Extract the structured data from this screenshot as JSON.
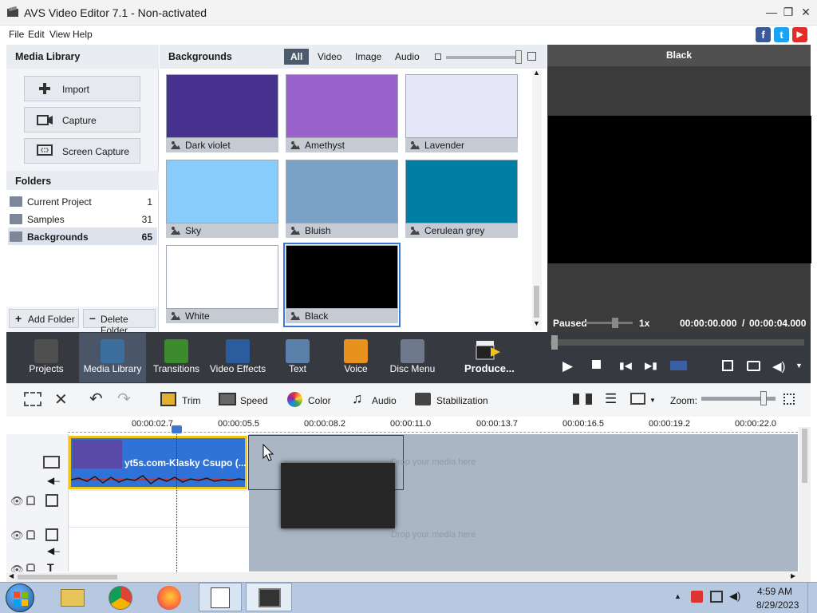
{
  "window": {
    "title": "AVS Video Editor 7.1 - Non-activated"
  },
  "menu": [
    "File",
    "Edit",
    "View",
    "Help"
  ],
  "social": [
    {
      "name": "facebook-icon",
      "glyph": "f",
      "color": "#3b5998"
    },
    {
      "name": "twitter-icon",
      "glyph": "t",
      "color": "#1da1f2"
    },
    {
      "name": "youtube-icon",
      "glyph": "▶",
      "color": "#e52d27"
    }
  ],
  "media_library": {
    "title": "Media Library",
    "buttons": [
      {
        "label": "Import",
        "icon": "plus-icon"
      },
      {
        "label": "Capture",
        "icon": "camera-icon"
      },
      {
        "label": "Screen Capture",
        "icon": "screen-capture-icon"
      }
    ],
    "folders_title": "Folders",
    "folders": [
      {
        "name": "Current Project",
        "count": "1"
      },
      {
        "name": "Samples",
        "count": "31"
      },
      {
        "name": "Backgrounds",
        "count": "65"
      }
    ],
    "add_folder": "Add Folder",
    "delete_folder": "Delete Folder"
  },
  "backgrounds": {
    "title": "Backgrounds",
    "tabs": [
      "All",
      "Video",
      "Image",
      "Audio"
    ],
    "active_tab": "All",
    "tiles": [
      {
        "name": "Dark violet",
        "color": "#46318f"
      },
      {
        "name": "Amethyst",
        "color": "#9c62cc"
      },
      {
        "name": "Lavender",
        "color": "#e6e6f9"
      },
      {
        "name": "Sky",
        "color": "#88ccfc"
      },
      {
        "name": "Bluish",
        "color": "#7aa2c6"
      },
      {
        "name": "Cerulean grey",
        "color": "#007fa5"
      },
      {
        "name": "White",
        "color": "#ffffff"
      },
      {
        "name": "Black",
        "color": "#000000"
      }
    ]
  },
  "preview": {
    "title": "Black",
    "status": "Paused",
    "speed": "1x",
    "time_current": "00:00:00.000",
    "time_sep": "/",
    "time_total": "00:00:04.000"
  },
  "modes": [
    {
      "label": "Projects",
      "icon": "projects-icon",
      "color": "#4f4f4f"
    },
    {
      "label": "Media Library",
      "icon": "media-library-icon",
      "color": "#3b6e9c"
    },
    {
      "label": "Transitions",
      "icon": "transitions-icon",
      "color": "#3b8b2e"
    },
    {
      "label": "Video Effects",
      "icon": "video-effects-icon",
      "color": "#2b5d9e"
    },
    {
      "label": "Text",
      "icon": "text-icon",
      "color": "#5a7fa8"
    },
    {
      "label": "Voice",
      "icon": "voice-icon",
      "color": "#e8911d"
    },
    {
      "label": "Disc Menu",
      "icon": "disc-menu-icon",
      "color": "#6e7a8c"
    }
  ],
  "produce_label": "Produce...",
  "timeline_tools": {
    "trim": "Trim",
    "speed": "Speed",
    "color": "Color",
    "audio": "Audio",
    "stabilization": "Stabilization",
    "zoom": "Zoom:"
  },
  "ruler": [
    "00:00:02.7",
    "00:00:05.5",
    "00:00:08.2",
    "00:00:11.0",
    "00:00:13.7",
    "00:00:16.5",
    "00:00:19.2",
    "00:00:22.0"
  ],
  "clip": {
    "title": "yt5s.com-Klasky Csupo (..."
  },
  "drop_text": "Drop your media here",
  "taskbar": {
    "time": "4:59 AM",
    "date": "8/29/2023"
  }
}
